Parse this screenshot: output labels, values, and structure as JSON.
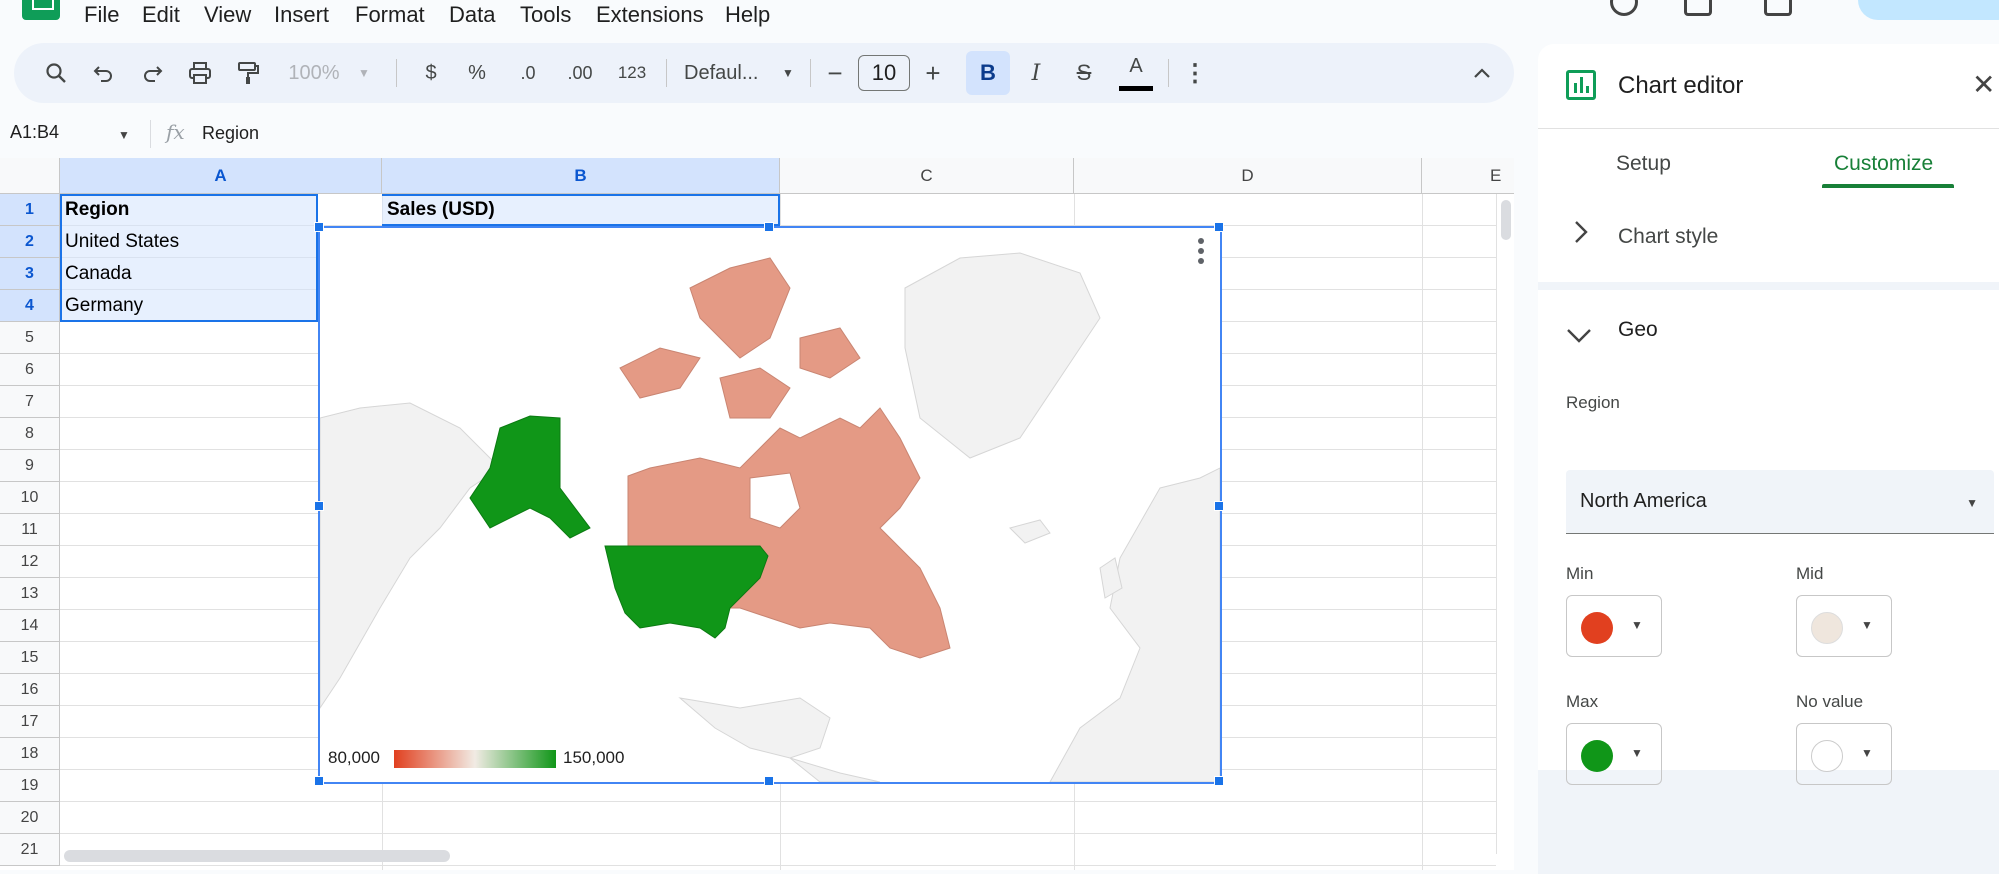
{
  "menu": {
    "items": [
      "File",
      "Edit",
      "View",
      "Insert",
      "Format",
      "Data",
      "Tools",
      "Extensions",
      "Help"
    ]
  },
  "toolbar": {
    "zoom": "100%",
    "currency": "$",
    "percent": "%",
    "decrease_decimal": ".0",
    "increase_decimal": ".00",
    "number_format": "123",
    "font": "Defaul...",
    "font_size": "10",
    "bold": "B",
    "italic": "I",
    "strike": "S",
    "text_color": "A"
  },
  "formula_bar": {
    "name_box": "A1:B4",
    "fx": "fx",
    "value": "Region"
  },
  "grid": {
    "columns": [
      "A",
      "B",
      "C",
      "D",
      "E"
    ],
    "rows": [
      "1",
      "2",
      "3",
      "4",
      "5",
      "6",
      "7",
      "8",
      "9",
      "10",
      "11",
      "12",
      "13",
      "14",
      "15",
      "16",
      "17",
      "18",
      "19",
      "20",
      "21"
    ],
    "cells": {
      "a1": "Region",
      "b1": "Sales (USD)",
      "a2": "United States",
      "a3": "Canada",
      "a4": "Germany"
    }
  },
  "chart": {
    "legend_min": "80,000",
    "legend_max": "150,000",
    "colors": {
      "min": "#e1401f",
      "mid": "#efe6dd",
      "max": "#109618",
      "canada": "#e49a85",
      "no_value": "#f2f2f2"
    }
  },
  "chart_data": {
    "type": "geo",
    "region": "North America",
    "regions": [
      "United States",
      "Canada",
      "Germany"
    ],
    "color_axis": {
      "min": 80000,
      "max": 150000,
      "min_label": "80,000",
      "max_label": "150,000"
    },
    "highlighted": {
      "United States": "max",
      "Canada": "lower"
    }
  },
  "editor": {
    "title": "Chart editor",
    "tabs": [
      "Setup",
      "Customize"
    ],
    "active_tab": "Customize",
    "section_chart_style": "Chart style",
    "section_geo": "Geo",
    "region_label": "Region",
    "region_value": "North America",
    "min_label": "Min",
    "mid_label": "Mid",
    "max_label": "Max",
    "no_value_label": "No value",
    "colors": {
      "min": "#e1401f",
      "mid": "#efe6dd",
      "max": "#109618",
      "no_value": "#ffffff"
    }
  }
}
